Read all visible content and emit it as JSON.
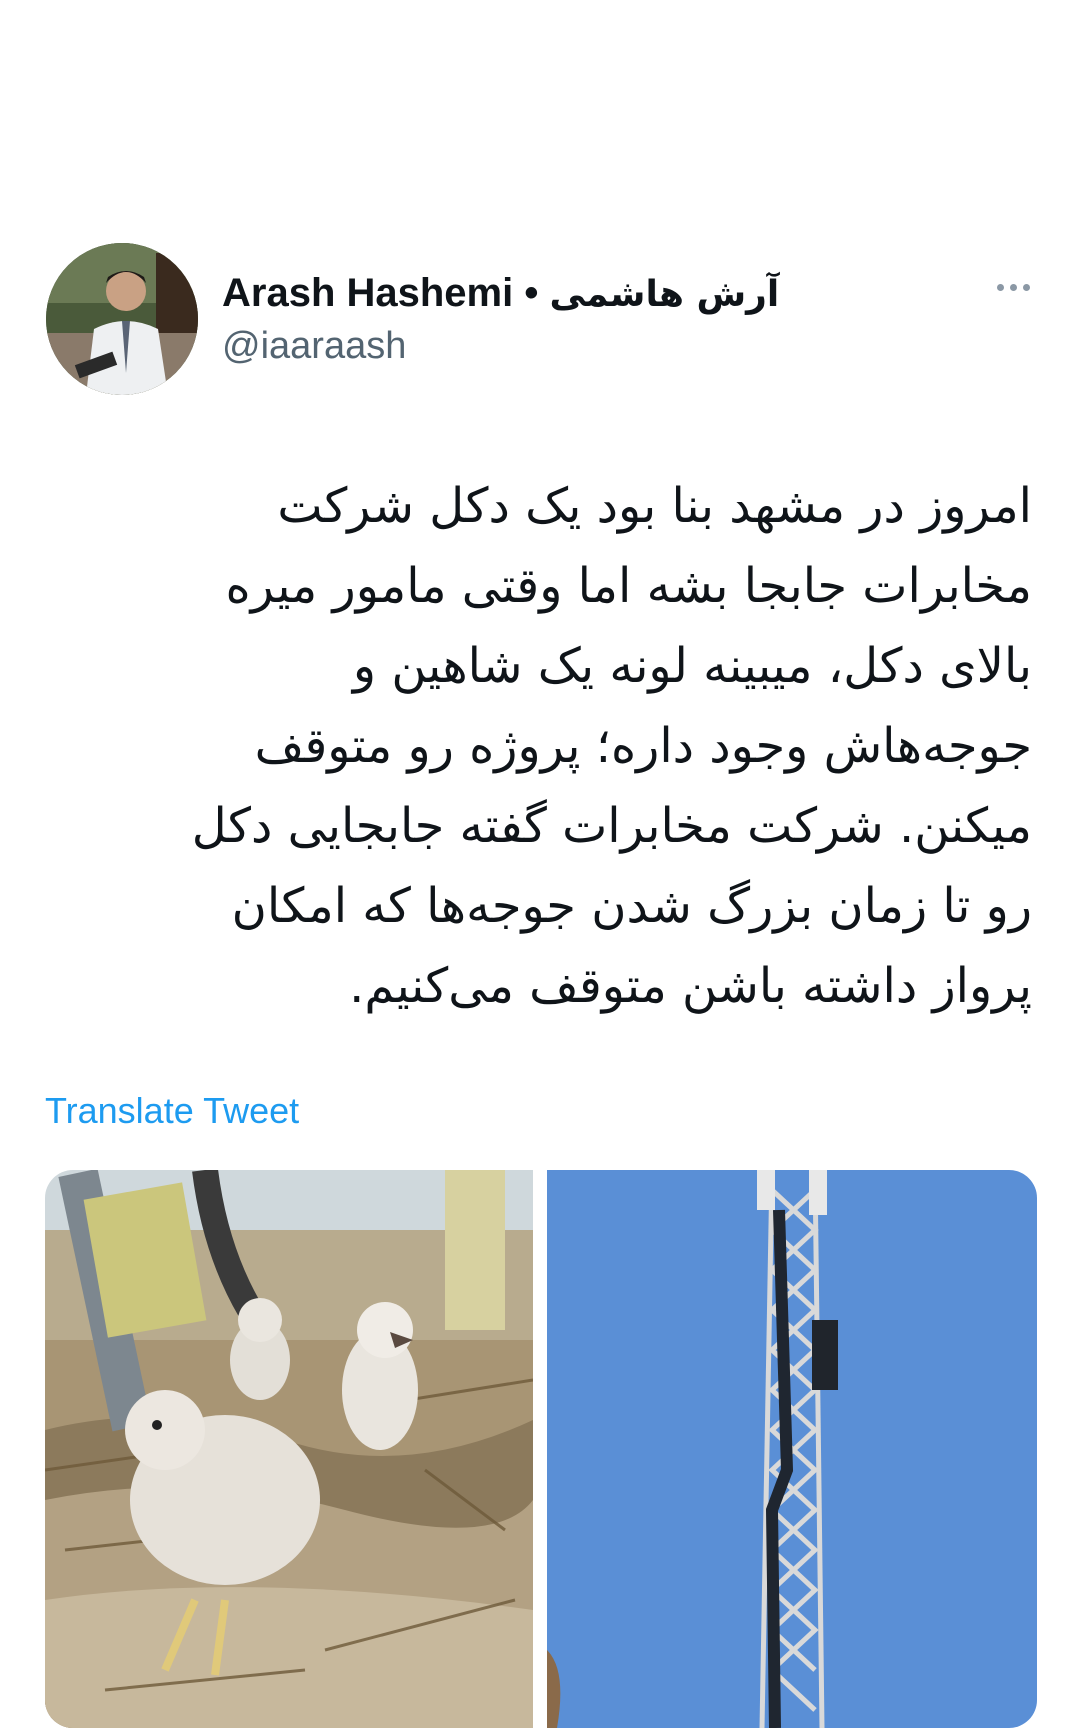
{
  "user": {
    "name_en": "Arash Hashemi",
    "separator": "•",
    "name_fa": "آرش هاشمی",
    "handle": "@iaaraash"
  },
  "tweet": {
    "lines": [
      "امروز در مشهد بنا بود یک دکل شرکت",
      "مخابرات جابجا بشه اما وقتی مامور میره",
      "بالای دکل، میبینه لونه یک شاهین و",
      "جوجه‌هاش وجود داره؛ پروژه رو متوقف",
      "میکنن. شرکت مخابرات گفته جابجایی دکل",
      "رو تا زمان بزرگ شدن جوجه‌ها که امکان",
      "پرواز داشته باشن متوقف می‌کنیم."
    ]
  },
  "actions": {
    "translate": "Translate Tweet"
  },
  "colors": {
    "link": "#1d9bf0",
    "handle": "#536471",
    "sky": "#5a8fd6"
  },
  "icons": {
    "more": "more-horizontal-icon"
  }
}
